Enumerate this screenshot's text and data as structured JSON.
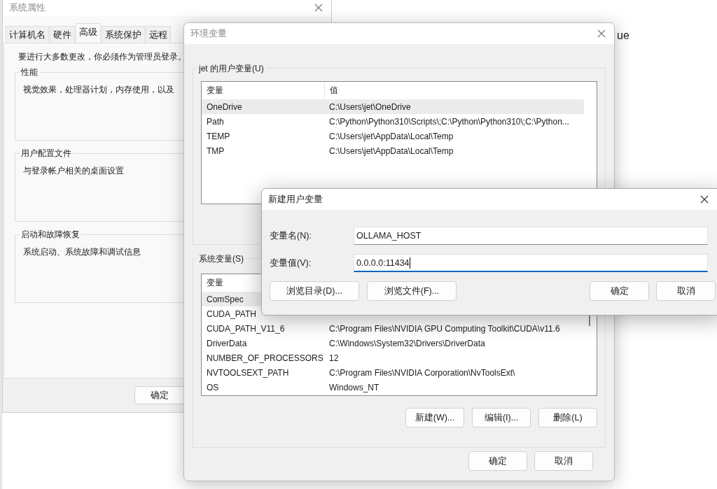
{
  "desktop_text": "ue",
  "system_properties": {
    "title": "系统属性",
    "tabs": [
      {
        "label": "计算机名",
        "selected": false
      },
      {
        "label": "硬件",
        "selected": false
      },
      {
        "label": "高级",
        "selected": true
      },
      {
        "label": "系统保护",
        "selected": false
      },
      {
        "label": "远程",
        "selected": false
      }
    ],
    "notice": "要进行大多数更改，你必须作为管理员登录。",
    "groups": [
      {
        "title": "性能",
        "description": "视觉效果，处理器计划，内存使用，以及"
      },
      {
        "title": "用户配置文件",
        "description": "与登录帐户相关的桌面设置"
      },
      {
        "title": "启动和故障恢复",
        "description": "系统启动、系统故障和调试信息"
      }
    ],
    "buttons": [
      "确定"
    ]
  },
  "environment_variables": {
    "title": "环境变量",
    "user_variables": {
      "title": "jet 的用户变量(U)",
      "columns": [
        "变量",
        "值"
      ],
      "rows": [
        {
          "name": "OneDrive",
          "value": "C:\\Users\\jet\\OneDrive",
          "selected": true
        },
        {
          "name": "Path",
          "value": "C:\\Python\\Python310\\Scripts\\;C:\\Python\\Python310\\;C:\\Python...",
          "selected": false
        },
        {
          "name": "TEMP",
          "value": "C:\\Users\\jet\\AppData\\Local\\Temp",
          "selected": false
        },
        {
          "name": "TMP",
          "value": "C:\\Users\\jet\\AppData\\Local\\Temp",
          "selected": false
        }
      ]
    },
    "system_variables": {
      "title": "系统变量(S)",
      "columns": [
        "变量"
      ],
      "rows": [
        {
          "name": "ComSpec",
          "selected": true
        },
        {
          "name": "CUDA_PATH",
          "selected": false
        },
        {
          "name": "CUDA_PATH_V11_6",
          "value": "C:\\Program Files\\NVIDIA GPU Computing Toolkit\\CUDA\\v11.6",
          "selected": false
        },
        {
          "name": "DriverData",
          "value": "C:\\Windows\\System32\\Drivers\\DriverData",
          "selected": false
        },
        {
          "name": "NUMBER_OF_PROCESSORS",
          "value": "12",
          "selected": false
        },
        {
          "name": "NVTOOLSEXT_PATH",
          "value": "C:\\Program Files\\NVIDIA Corporation\\NvToolsExt\\",
          "selected": false
        },
        {
          "name": "OS",
          "value": "Windows_NT",
          "selected": false
        }
      ]
    },
    "list_buttons": [
      "新建(W)...",
      "编辑(I)...",
      "删除(L)"
    ],
    "buttons": [
      "确定",
      "取消"
    ]
  },
  "new_user_variable": {
    "title": "新建用户变量",
    "fields": [
      {
        "label": "变量名(N):",
        "value": "OLLAMA_HOST",
        "focused": false
      },
      {
        "label": "变量值(V):",
        "value": "0.0.0.0:11434",
        "focused": true
      }
    ],
    "browse_buttons": [
      "浏览目录(D)...",
      "浏览文件(F)..."
    ],
    "buttons": [
      "确定",
      "取消"
    ]
  }
}
